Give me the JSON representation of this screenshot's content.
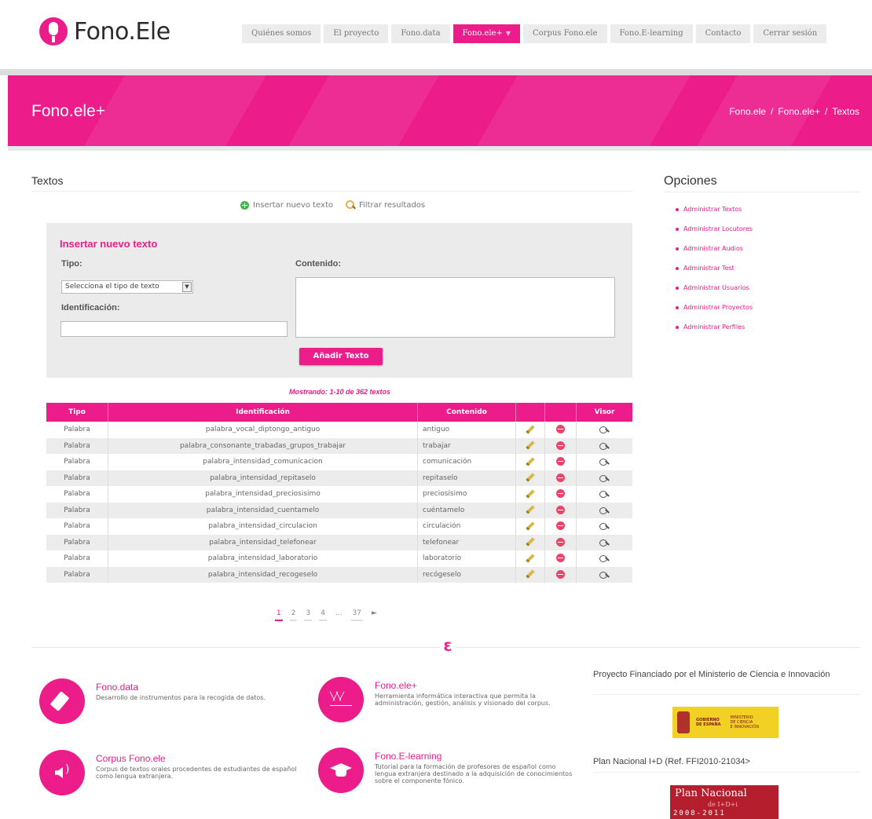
{
  "brand": {
    "name": "Fono.Ele",
    "accent": "#ec1c8a"
  },
  "nav": [
    {
      "label": "Quiénes somos",
      "active": false
    },
    {
      "label": "El proyecto",
      "active": false
    },
    {
      "label": "Fono.data",
      "active": false
    },
    {
      "label": "Fono.ele+",
      "active": true,
      "has_dropdown": true
    },
    {
      "label": "Corpus Fono.ele",
      "active": false
    },
    {
      "label": "Fono.E-learning",
      "active": false
    },
    {
      "label": "Contacto",
      "active": false
    },
    {
      "label": "Cerrar sesión",
      "active": false
    }
  ],
  "banner": {
    "title": "Fono.ele+",
    "breadcrumb": [
      "Fono.ele",
      "Fono.ele+",
      "Textos"
    ],
    "separator": "/"
  },
  "main": {
    "title": "Textos",
    "actions": {
      "insert": "Insertar nuevo texto",
      "filter": "Filtrar resultados"
    },
    "form": {
      "title": "Insertar nuevo texto",
      "tipo_label": "Tipo:",
      "tipo_value": "Selecciona el tipo de texto",
      "id_label": "Identificación:",
      "contenido_label": "Contenido:",
      "submit_label": "Añadir Texto"
    },
    "showing": "Mostrando: 1-10 de 362 textos",
    "table": {
      "headers": {
        "tipo": "Tipo",
        "id": "Identificación",
        "contenido": "Contenido",
        "visor": "Visor"
      },
      "rows": [
        {
          "tipo": "Palabra",
          "id": "palabra_vocal_diptongo_antiguo",
          "contenido": "antiguo"
        },
        {
          "tipo": "Palabra",
          "id": "palabra_consonante_trabadas_grupos_trabajar",
          "contenido": "trabajar"
        },
        {
          "tipo": "Palabra",
          "id": "palabra_intensidad_comunicacion",
          "contenido": "comunicación"
        },
        {
          "tipo": "Palabra",
          "id": "palabra_intensidad_repitaselo",
          "contenido": "repitaselo"
        },
        {
          "tipo": "Palabra",
          "id": "palabra_intensidad_preciosisimo",
          "contenido": "preciosísimo"
        },
        {
          "tipo": "Palabra",
          "id": "palabra_intensidad_cuentamelo",
          "contenido": "cuéntamelo"
        },
        {
          "tipo": "Palabra",
          "id": "palabra_intensidad_circulacion",
          "contenido": "circulación"
        },
        {
          "tipo": "Palabra",
          "id": "palabra_intensidad_telefonear",
          "contenido": "telefonear"
        },
        {
          "tipo": "Palabra",
          "id": "palabra_intensidad_laboratorio",
          "contenido": "laboratorio"
        },
        {
          "tipo": "Palabra",
          "id": "palabra_intensidad_recogeselo",
          "contenido": "recógeselo"
        }
      ]
    },
    "pagination": {
      "pages": [
        "1",
        "2",
        "3",
        "4"
      ],
      "ellipsis": "...",
      "last": "37",
      "next": "►",
      "current": "1"
    }
  },
  "sidebar": {
    "title": "Opciones",
    "items": [
      "Administrar Textos",
      "Administrar Locutores",
      "Administrar Audios",
      "Administrar Test",
      "Administrar Usuarios",
      "Administrar Proyectos",
      "Administrar Perfiles"
    ]
  },
  "footer": {
    "features": [
      {
        "title": "Fono.data",
        "desc": "Desarrollo de instrumentos para la recogida de datos.",
        "icon": "usb-icon"
      },
      {
        "title": "Fono.ele+",
        "desc": "Herramienta informática interactiva que permita la administración, gestión, análisis y visionado del corpus.",
        "icon": "chart-icon"
      },
      {
        "title": "Corpus Fono.ele",
        "desc": "Corpus de textos orales procedentes de estudiantes de español como lengua extranjera.",
        "icon": "speaker-icon"
      },
      {
        "title": "Fono.E-learning",
        "desc": "Tutorial para la formación de profesores de español como lengua extranjera destinado a la adquisición de conocimientos sobre el componente fónico.",
        "icon": "graduation-cap-icon"
      }
    ],
    "funding_title": "Proyecto Financiado por el Ministerio de Ciencia e Innovación",
    "gov_logo": {
      "line1": "GOBIERNO",
      "line2": "DE ESPAÑA",
      "line3": "MINISTERIO",
      "line4": "DE CIENCIA",
      "line5": "E INNOVACIÓN"
    },
    "plan_title": "Plan Nacional I+D (Ref. FFI2010-21034>",
    "plan_logo": {
      "line1": "Plan Nacional",
      "line2": "de I+D+i",
      "line3": "2008-2011"
    }
  }
}
